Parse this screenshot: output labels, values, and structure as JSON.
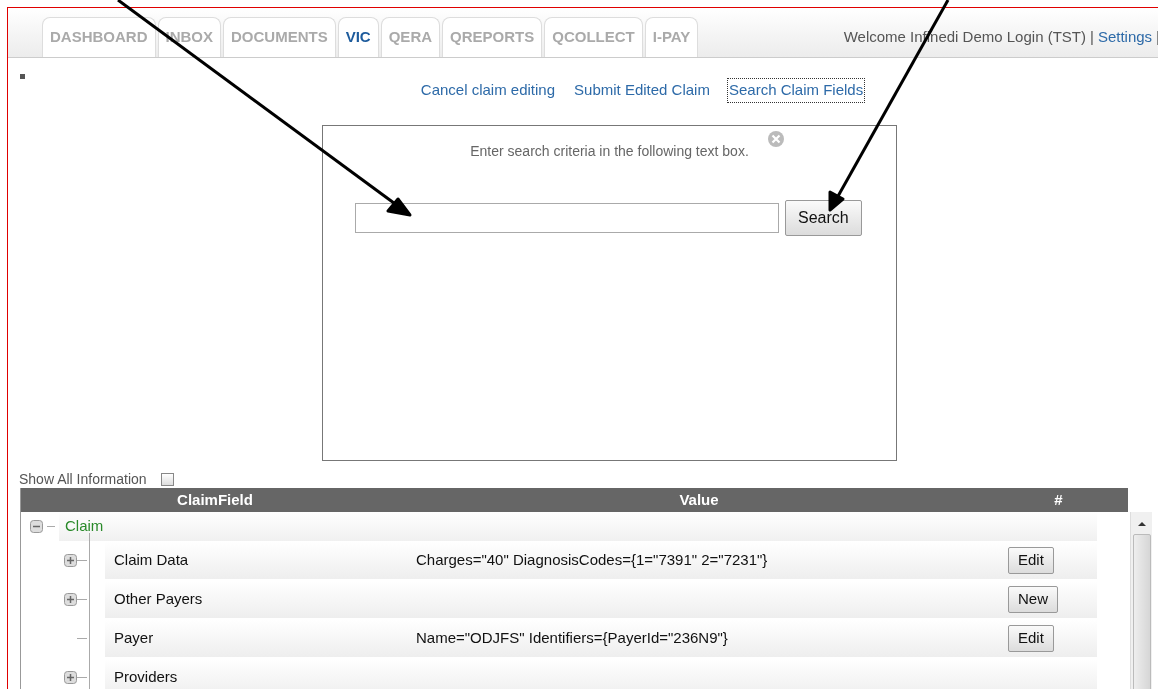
{
  "tabs": [
    {
      "label": "DASHBOARD",
      "selected": false
    },
    {
      "label": "INBOX",
      "selected": false
    },
    {
      "label": "DOCUMENTS",
      "selected": false
    },
    {
      "label": "VIC",
      "selected": true
    },
    {
      "label": "QERA",
      "selected": false
    },
    {
      "label": "QREPORTS",
      "selected": false
    },
    {
      "label": "QCOLLECT",
      "selected": false
    },
    {
      "label": "I-PAY",
      "selected": false
    }
  ],
  "user_bar": {
    "welcome": "Welcome Infinedi Demo Login (TST)",
    "separator": "|",
    "settings": "Settings",
    "trailing_separator": "|"
  },
  "actions": [
    {
      "label": "Cancel claim editing",
      "focused": false
    },
    {
      "label": "Submit Edited Claim",
      "focused": false
    },
    {
      "label": "Search Claim Fields",
      "focused": true
    }
  ],
  "search_dialog": {
    "instruction": "Enter search criteria in the following text box.",
    "button": "Search"
  },
  "show_all": {
    "label": "Show All Information",
    "checked": false
  },
  "table": {
    "columns": [
      "ClaimField",
      "Value",
      "#"
    ],
    "tree": [
      {
        "label": "Claim",
        "kind": "group",
        "expanded": true,
        "children": [
          {
            "label": "Claim Data",
            "kind": "group",
            "expanded": false,
            "value": "Charges=\"40\" DiagnosisCodes={1=\"7391\" 2=\"7231\"}",
            "button": "Edit"
          },
          {
            "label": "Other Payers",
            "kind": "group",
            "expanded": false,
            "button": "New"
          },
          {
            "label": "Payer",
            "kind": "leaf",
            "value": "Name=\"ODJFS\" Identifiers={PayerId=\"236N9\"}",
            "button": "Edit"
          },
          {
            "label": "Providers",
            "kind": "group",
            "expanded": false
          }
        ]
      }
    ]
  }
}
